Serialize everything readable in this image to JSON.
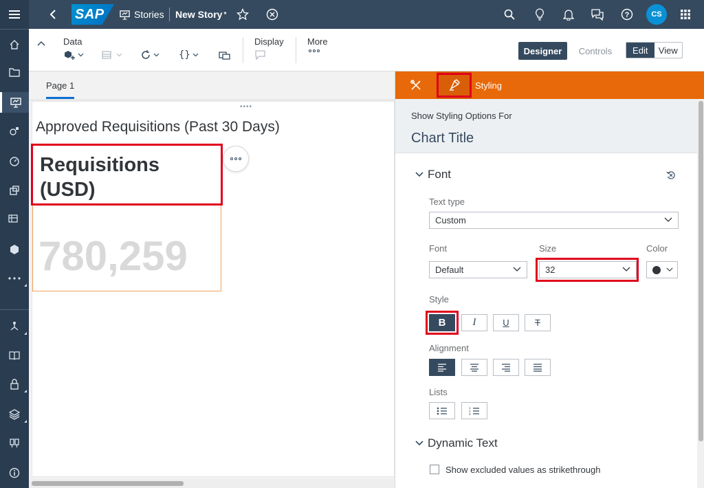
{
  "shell": {
    "brand": "SAP",
    "stories_label": "Stories",
    "story_title": "New Story",
    "dirty_marker": "*",
    "user_initials": "CS"
  },
  "toolbar": {
    "data_label": "Data",
    "display_label": "Display",
    "more_label": "More",
    "designer_label": "Designer",
    "controls_label": "Controls",
    "edit_label": "Edit",
    "view_label": "View"
  },
  "page": {
    "tab_label": "Page 1",
    "canvas_title": "Approved Requisitions (Past 30 Days)",
    "tile_title": "Requisitions (USD)",
    "tile_value": "780,259"
  },
  "panel": {
    "header_title": "Styling",
    "show_for_label": "Show Styling Options For",
    "target": "Chart Title",
    "font_section": "Font",
    "text_type_label": "Text type",
    "text_type_value": "Custom",
    "font_label": "Font",
    "font_value": "Default",
    "size_label": "Size",
    "size_value": "32",
    "color_label": "Color",
    "style_label": "Style",
    "style_bold": "B",
    "style_italic": "I",
    "style_underline": "U",
    "style_strike": "T",
    "alignment_label": "Alignment",
    "lists_label": "Lists",
    "dynamic_text_section": "Dynamic Text",
    "strikethrough_label": "Show excluded values as strikethrough"
  },
  "colors": {
    "shell": "#354a5f",
    "nav": "#2a3c4f",
    "panel_header": "#e8690a",
    "highlight": "#e0001b",
    "tile_border": "#f0a35a"
  }
}
